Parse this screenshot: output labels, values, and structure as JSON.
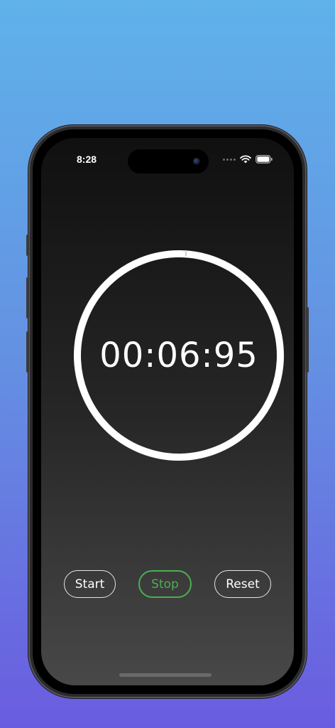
{
  "status_bar": {
    "time": "8:28",
    "icons": [
      "cellular-icon",
      "wifi-icon",
      "battery-icon"
    ]
  },
  "stopwatch": {
    "display": "00:06:95"
  },
  "controls": {
    "start_label": "Start",
    "stop_label": "Stop",
    "reset_label": "Reset"
  },
  "colors": {
    "background_top": "#5fb2ea",
    "background_bottom": "#6a5ce0",
    "ring": "#ffffff",
    "stop_accent": "#4caf50"
  }
}
